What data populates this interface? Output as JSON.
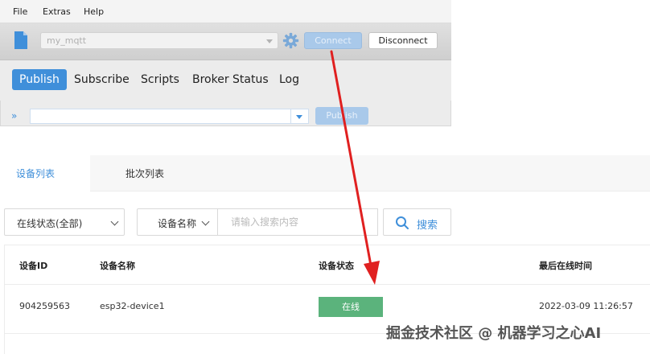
{
  "mqtt": {
    "menu": [
      "File",
      "Extras",
      "Help"
    ],
    "profile_value": "my_mqtt",
    "connect_label": "Connect",
    "disconnect_label": "Disconnect",
    "tabs": [
      "Publish",
      "Subscribe",
      "Scripts",
      "Broker Status",
      "Log"
    ],
    "publish_label": "Publish",
    "topic_value": ""
  },
  "device_panel": {
    "tabs": [
      "设备列表",
      "批次列表"
    ],
    "status_filter": "在线状态(全部)",
    "field_filter": "设备名称",
    "search_placeholder": "请输入搜索内容",
    "search_label": "搜索",
    "columns": [
      "设备ID",
      "设备名称",
      "设备状态",
      "最后在线时间"
    ],
    "rows": [
      {
        "id": "904259563",
        "name": "esp32-device1",
        "status": "在线",
        "last_online": "2022-03-09 11:26:57"
      }
    ]
  },
  "colors": {
    "accent": "#3f8fda",
    "online": "#5bb37c",
    "arrow": "#e02020"
  },
  "watermark": "掘金技术社区 @ 机器学习之心AI"
}
